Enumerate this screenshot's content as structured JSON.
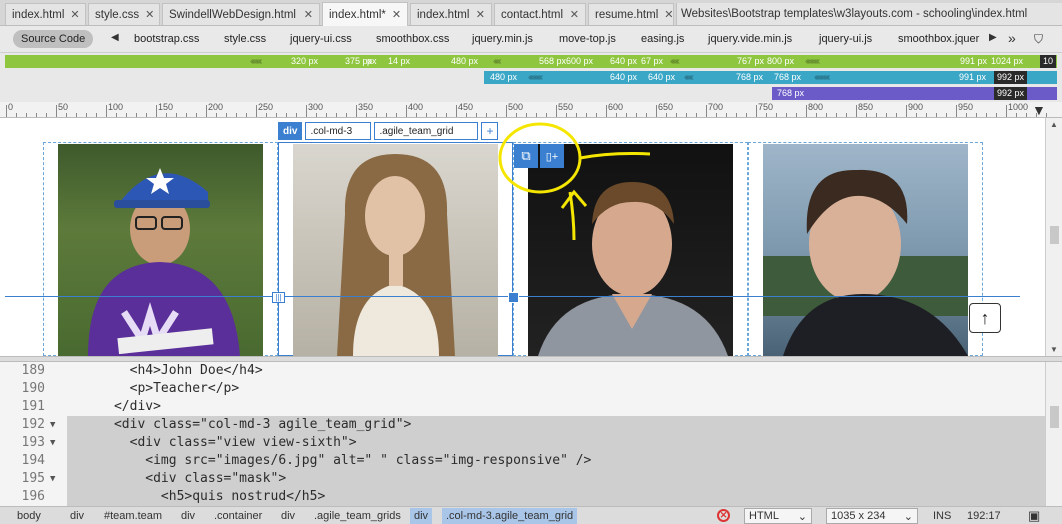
{
  "tabs": [
    {
      "label": "index.html",
      "active": false
    },
    {
      "label": "style.css",
      "active": false
    },
    {
      "label": "SwindellWebDesign.html",
      "active": false
    },
    {
      "label": "index.html*",
      "active": true
    },
    {
      "label": "index.html",
      "active": false
    },
    {
      "label": "contact.html",
      "active": false
    },
    {
      "label": "resume.html",
      "active": false
    }
  ],
  "doc_path": "Websites\\Bootstrap templates\\w3layouts.com - schooling\\index.html",
  "related": {
    "source_code_label": "Source Code",
    "files": [
      "bootstrap.css",
      "style.css",
      "jquery-ui.css",
      "smoothbox.css",
      "jquery.min.js",
      "move-top.js",
      "easing.js",
      "jquery.vide.min.js",
      "jquery-ui.js",
      "smoothbox.jquer"
    ]
  },
  "media_queries": {
    "row1": [
      "320 px",
      "375 px",
      "px",
      "14 px",
      "480 px",
      "568 px",
      "600 px",
      "640 px",
      "67 px",
      "767 px",
      "800 px",
      "991 px",
      "1024 px",
      "10"
    ],
    "row2": [
      "480 px",
      "640 px",
      "640 px",
      "768 px",
      "768 px",
      "991 px",
      "992 px"
    ],
    "row3": [
      "768 px",
      "992 px"
    ]
  },
  "ruler": [
    "0",
    "50",
    "100",
    "150",
    "200",
    "250",
    "300",
    "350",
    "400",
    "450",
    "500",
    "550",
    "600",
    "650",
    "700",
    "750",
    "800",
    "850",
    "900",
    "950",
    "1000"
  ],
  "selection": {
    "tag": "div",
    "class1": ".col-md-3",
    "class2": ".agile_team_grid",
    "add": "+"
  },
  "code": [
    {
      "n": "189",
      "fold": "",
      "text": "        <h4>John Doe</h4>",
      "hl": false
    },
    {
      "n": "190",
      "fold": "",
      "text": "        <p>Teacher</p>",
      "hl": false
    },
    {
      "n": "191",
      "fold": "",
      "text": "      </div>",
      "hl": false
    },
    {
      "n": "192",
      "fold": "▼",
      "text": "      <div class=\"col-md-3 agile_team_grid\">",
      "hl": true
    },
    {
      "n": "193",
      "fold": "▼",
      "text": "        <div class=\"view view-sixth\">",
      "hl": true
    },
    {
      "n": "194",
      "fold": "",
      "text": "          <img src=\"images/6.jpg\" alt=\" \" class=\"img-responsive\" />",
      "hl": true
    },
    {
      "n": "195",
      "fold": "▼",
      "text": "          <div class=\"mask\">",
      "hl": true
    },
    {
      "n": "196",
      "fold": "",
      "text": "            <h5>quis nostrud</h5>",
      "hl": true
    }
  ],
  "status": {
    "crumbs": [
      "body",
      "div",
      "#team.team",
      "div",
      ".container",
      "div",
      ".agile_team_grids",
      "div",
      ".col-md-3.agile_team_grid"
    ],
    "doc_type": "HTML",
    "size": "1035 x 234",
    "mode": "INS",
    "position": "192:17"
  },
  "colors": {
    "accent": "#3a7fd0",
    "mq_green": "#8fc640",
    "mq_blue": "#3aa7c7",
    "mq_purple": "#6a5bc8",
    "annotation": "#f5e600"
  }
}
